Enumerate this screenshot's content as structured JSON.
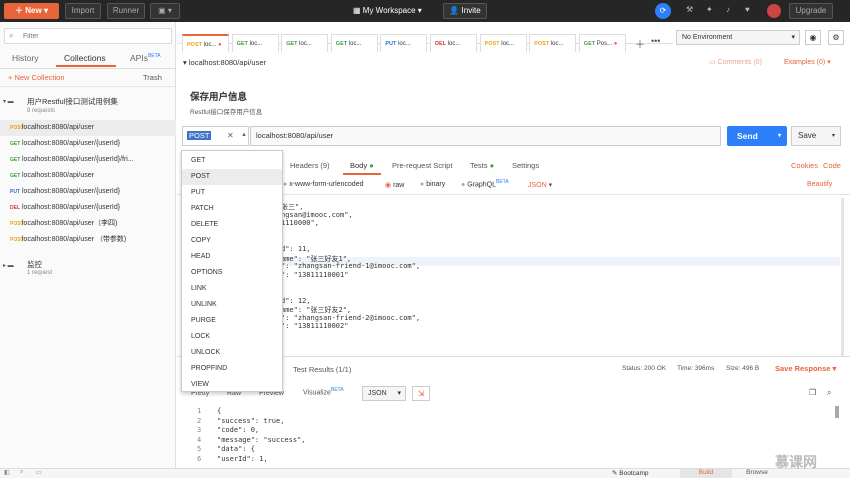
{
  "topbar": {
    "new": "New",
    "import": "Import",
    "runner": "Runner",
    "workspace": "My Workspace",
    "invite": "Invite",
    "upgrade": "Upgrade"
  },
  "sidebar": {
    "filter_placeholder": "Filter",
    "tabs": [
      "History",
      "Collections",
      "APIs"
    ],
    "apis_badge": "BETA",
    "new_collection": "New Collection",
    "trash": "Trash",
    "collections": [
      {
        "name": "用户Restful接口测试用例集",
        "count": "8 requests"
      },
      {
        "name": "监控",
        "count": "1 request"
      }
    ],
    "requests": [
      {
        "m": "POST",
        "u": "localhost:8080/api/user"
      },
      {
        "m": "GET",
        "u": "localhost:8080/api/user/{userId}"
      },
      {
        "m": "GET",
        "u": "localhost:8080/api/user/{userId}/fri..."
      },
      {
        "m": "GET",
        "u": "localhost:8080/api/user"
      },
      {
        "m": "PUT",
        "u": "localhost:8080/api/user/{userId}"
      },
      {
        "m": "DEL",
        "u": "localhost:8080/api/user/{userId}"
      },
      {
        "m": "POST",
        "u": "localhost:8080/api/user（李四)"
      },
      {
        "m": "POST",
        "u": "localhost:8080/api/user （带参数)"
      }
    ]
  },
  "tabs": [
    {
      "m": "POST",
      "t": "loc..."
    },
    {
      "m": "GET",
      "t": "loc..."
    },
    {
      "m": "GET",
      "t": "loc..."
    },
    {
      "m": "GET",
      "t": "loc..."
    },
    {
      "m": "PUT",
      "t": "loc..."
    },
    {
      "m": "DEL",
      "t": "loc..."
    },
    {
      "m": "POST",
      "t": "loc..."
    },
    {
      "m": "POST",
      "t": "loc..."
    },
    {
      "m": "GET",
      "t": "Pos..."
    }
  ],
  "env": {
    "value": "No Environment"
  },
  "request": {
    "breadcrumb": "localhost:8080/api/user",
    "comments": "Comments (0)",
    "examples": "Examples (0)",
    "title": "保存用户信息",
    "desc": "Restful接口保存用户信息",
    "method": "POST",
    "url": "localhost:8080/api/user",
    "send": "Send",
    "save": "Save"
  },
  "req_tabs": [
    "Headers (9)",
    "Body",
    "Pre-request Script",
    "Tests",
    "Settings"
  ],
  "cookies": "Cookies",
  "code_link": "Code",
  "body_opts": [
    "x-www-form-urlencoded",
    "raw",
    "binary",
    "GraphQL"
  ],
  "graphql_badge": "BETA",
  "json": "JSON",
  "beautify": "Beautify",
  "methods": [
    "GET",
    "POST",
    "PUT",
    "PATCH",
    "DELETE",
    "COPY",
    "HEAD",
    "OPTIONS",
    "LINK",
    "UNLINK",
    "PURGE",
    "LOCK",
    "UNLOCK",
    "PROPFIND",
    "VIEW"
  ],
  "body_lines": [
    "张三\",",
    "ngsan@imooc.com\",",
    "1110000\",",
    "",
    "",
    "d\": 11,",
    "ame\": \"张三好友1\",",
    "\": \"zhangsan-friend-1@imooc.com\",",
    "\": \"13811110001\"",
    "",
    "",
    "d\": 12,",
    "ame\": \"张三好友2\",",
    "\": \"zhangsan-friend-2@imooc.com\",",
    "\": \"13811110002\""
  ],
  "response": {
    "test_results": "Test Results (1/1)",
    "status": "Status: 200 OK",
    "time": "Time: 396ms",
    "size": "Size: 496 B",
    "save_response": "Save Response",
    "modes": [
      "Pretty",
      "Raw",
      "Preview",
      "Visualize"
    ],
    "visualize_badge": "BETA",
    "format": "JSON",
    "lines": [
      "{",
      "    \"success\": true,",
      "    \"code\": 0,",
      "    \"message\": \"success\",",
      "    \"data\": {",
      "        \"userId\": 1,"
    ]
  },
  "bottom": {
    "bootcamp": "Bootcamp",
    "build": "Build",
    "browse": "Browse"
  },
  "watermark": "慕课网"
}
